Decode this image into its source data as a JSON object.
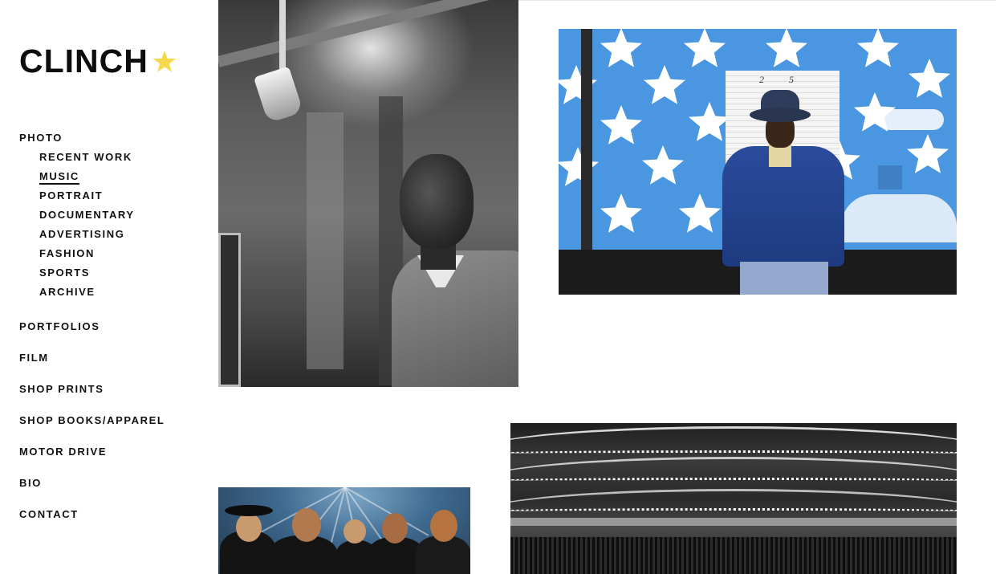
{
  "brand": {
    "name": "CLINCH",
    "star_color": "#f6d94a"
  },
  "nav": {
    "photo": "PHOTO",
    "photo_sub": [
      {
        "label": "RECENT WORK",
        "active": false
      },
      {
        "label": "MUSIC",
        "active": true
      },
      {
        "label": "PORTRAIT",
        "active": false
      },
      {
        "label": "DOCUMENTARY",
        "active": false
      },
      {
        "label": "ADVERTISING",
        "active": false
      },
      {
        "label": "FASHION",
        "active": false
      },
      {
        "label": "SPORTS",
        "active": false
      },
      {
        "label": "ARCHIVE",
        "active": false
      }
    ],
    "portfolios": "PORTFOLIOS",
    "film": "FILM",
    "shop_prints": "SHOP PRINTS",
    "shop_books": "SHOP BOOKS/APPAREL",
    "motor_drive": "MOTOR DRIVE",
    "bio": "BIO",
    "contact": "CONTACT"
  },
  "gallery": {
    "door_number": "2 5"
  },
  "colors": {
    "text": "#111111",
    "background": "#ffffff",
    "sky_blue": "#4a96e0"
  }
}
